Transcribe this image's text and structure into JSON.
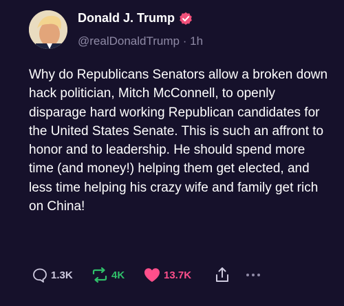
{
  "post": {
    "author_name": "Donald J. Trump",
    "handle": "@realDonaldTrump",
    "separator": "·",
    "time": "1h",
    "text": "Why do Republicans Senators allow a broken down hack politician, Mitch McConnell, to openly disparage hard working Republican candidates for the United States Senate. This is such an affront to honor and to leadership. He should spend more time (and money!) helping them get elected, and less time helping his crazy wife and family get rich on China!"
  },
  "actions": {
    "replies": "1.3K",
    "reposts": "4K",
    "likes": "13.7K"
  },
  "icons": {
    "verified": "verified-badge-icon",
    "reply": "reply-bubble-icon",
    "repost": "repost-arrows-icon",
    "like": "heart-icon",
    "share": "share-icon",
    "more": "more-dots-icon"
  },
  "colors": {
    "background": "#16112b",
    "verified_badge": "#f0507a",
    "repost": "#30c06a",
    "like": "#ff4f8b",
    "muted": "#8f8aa6"
  }
}
